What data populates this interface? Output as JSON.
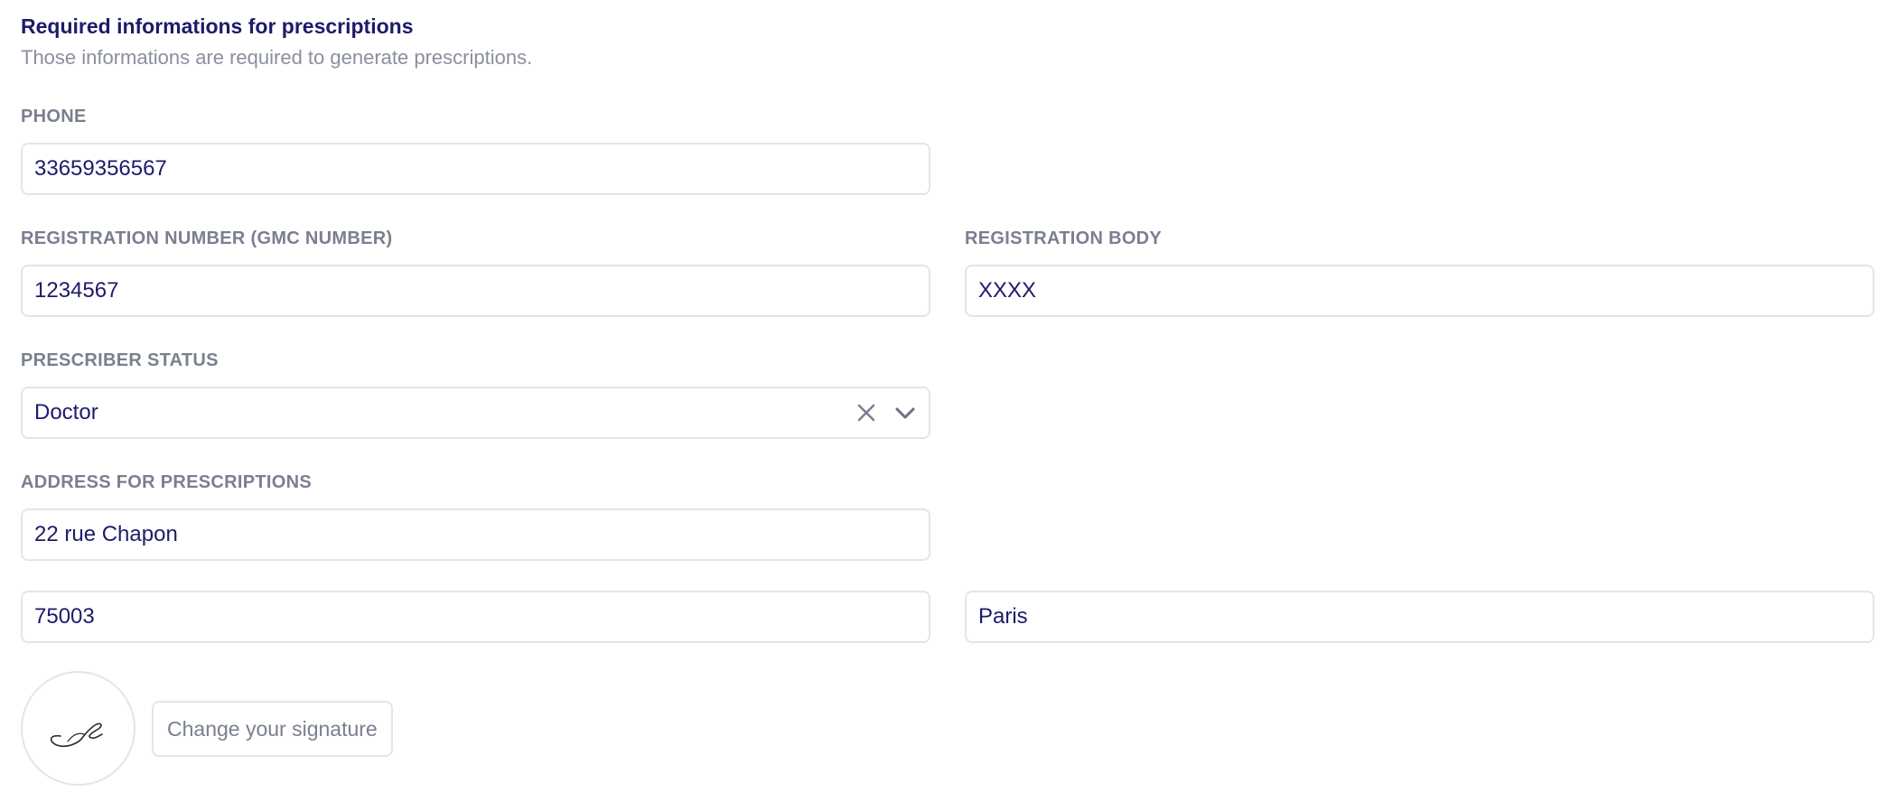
{
  "section": {
    "title": "Required informations for prescriptions",
    "description": "Those informations are required to generate prescriptions."
  },
  "fields": {
    "phone": {
      "label": "PHONE",
      "value": "33659356567"
    },
    "registration_number": {
      "label": "REGISTRATION NUMBER (GMC NUMBER)",
      "value": "1234567"
    },
    "registration_body": {
      "label": "REGISTRATION BODY",
      "value": "XXXX"
    },
    "prescriber_status": {
      "label": "PRESCRIBER STATUS",
      "value": "Doctor",
      "clear_icon": "close-icon",
      "dropdown_icon": "chevron-down-icon"
    },
    "address": {
      "label": "ADDRESS FOR PRESCRIPTIONS",
      "street": "22 rue Chapon",
      "postal_code": "75003",
      "city": "Paris"
    }
  },
  "signature": {
    "change_label": "Change your signature"
  },
  "colors": {
    "title": "#1e1b6b",
    "value_text": "#1e1b6b",
    "label_text": "#7a7f90",
    "border": "#e3e5ea"
  }
}
